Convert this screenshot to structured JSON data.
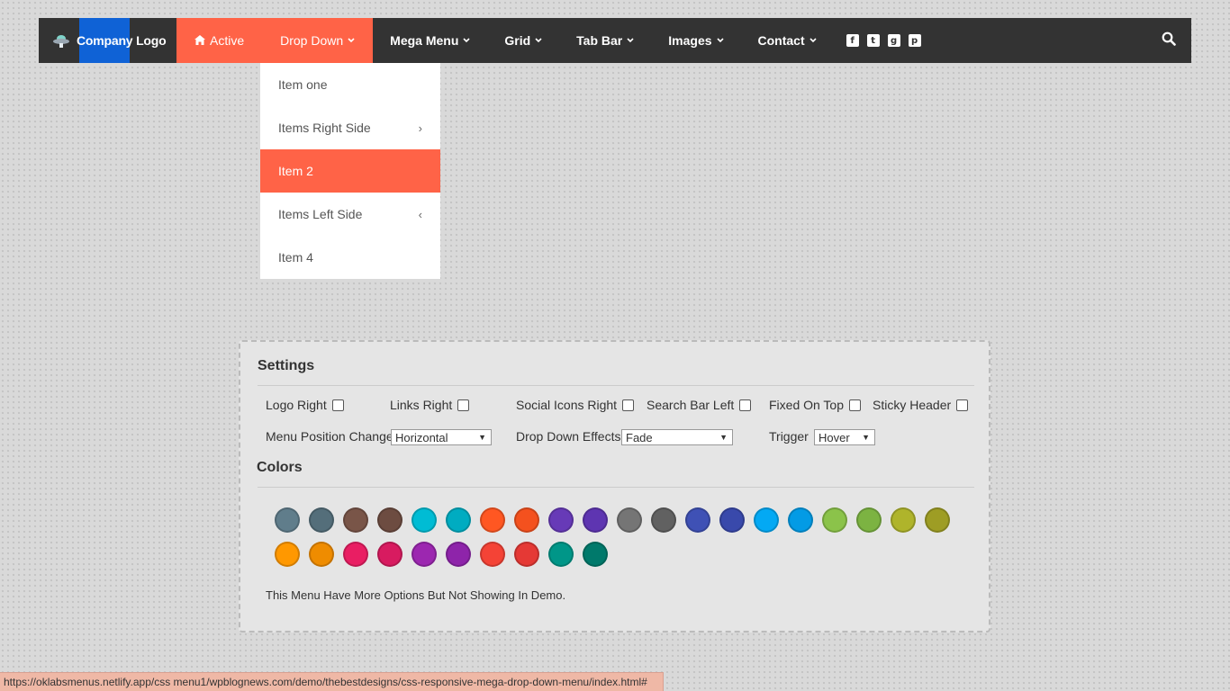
{
  "navbar": {
    "logo_text": "Company Logo",
    "items": [
      {
        "label": "Active",
        "icon": "home-icon"
      },
      {
        "label": "Drop Down"
      },
      {
        "label": "Mega Menu"
      },
      {
        "label": "Grid"
      },
      {
        "label": "Tab Bar"
      },
      {
        "label": "Images"
      },
      {
        "label": "Contact"
      }
    ],
    "social_icons": [
      "facebook-icon",
      "twitter-icon",
      "google-plus-icon",
      "pinterest-icon"
    ],
    "accent_color": "#ff6347",
    "logo_highlight_color": "#0f62d6",
    "bar_color": "#333333"
  },
  "dropdown": {
    "items": [
      {
        "label": "Item one"
      },
      {
        "label": "Items Right Side",
        "arrow": "›"
      },
      {
        "label": "Item 2"
      },
      {
        "label": "Items Left Side",
        "arrow": "‹"
      },
      {
        "label": "Item 4"
      }
    ]
  },
  "settings": {
    "title": "Settings",
    "checkboxes": [
      {
        "label": "Logo Right",
        "checked": false
      },
      {
        "label": "Links Right",
        "checked": false
      },
      {
        "label": "Social Icons Right",
        "checked": false
      },
      {
        "label": "Search Bar Left",
        "checked": false
      },
      {
        "label": "Fixed On Top",
        "checked": false
      },
      {
        "label": "Sticky Header",
        "checked": false
      }
    ],
    "menu_position": {
      "label": "Menu Position Change",
      "value": "Horizontal"
    },
    "drop_down_effects": {
      "label": "Drop Down Effects",
      "value": "Fade"
    },
    "trigger": {
      "label": "Trigger",
      "value": "Hover"
    },
    "colors_title": "Colors",
    "colors": [
      "#607d8b",
      "#546e7a",
      "#795548",
      "#6d4c41",
      "#00bcd4",
      "#00acc1",
      "#ff5722",
      "#f4511e",
      "#673ab7",
      "#5e35b1",
      "#757575",
      "#616161",
      "#3f51b5",
      "#3949ab",
      "#03a9f4",
      "#039be5",
      "#8bc34a",
      "#7cb342",
      "#afb42b",
      "#9e9d24",
      "#ff9800",
      "#ef8c00",
      "#e91e63",
      "#d81b60",
      "#9c27b0",
      "#8e24aa",
      "#f44336",
      "#e53935",
      "#009688",
      "#00796b"
    ],
    "note": "This Menu Have More Options But Not Showing In Demo."
  },
  "status_bar": {
    "url": "https://oklabsmenus.netlify.app/css menu1/wpblognews.com/demo/thebestdesigns/css-responsive-mega-drop-down-menu/index.html#"
  }
}
